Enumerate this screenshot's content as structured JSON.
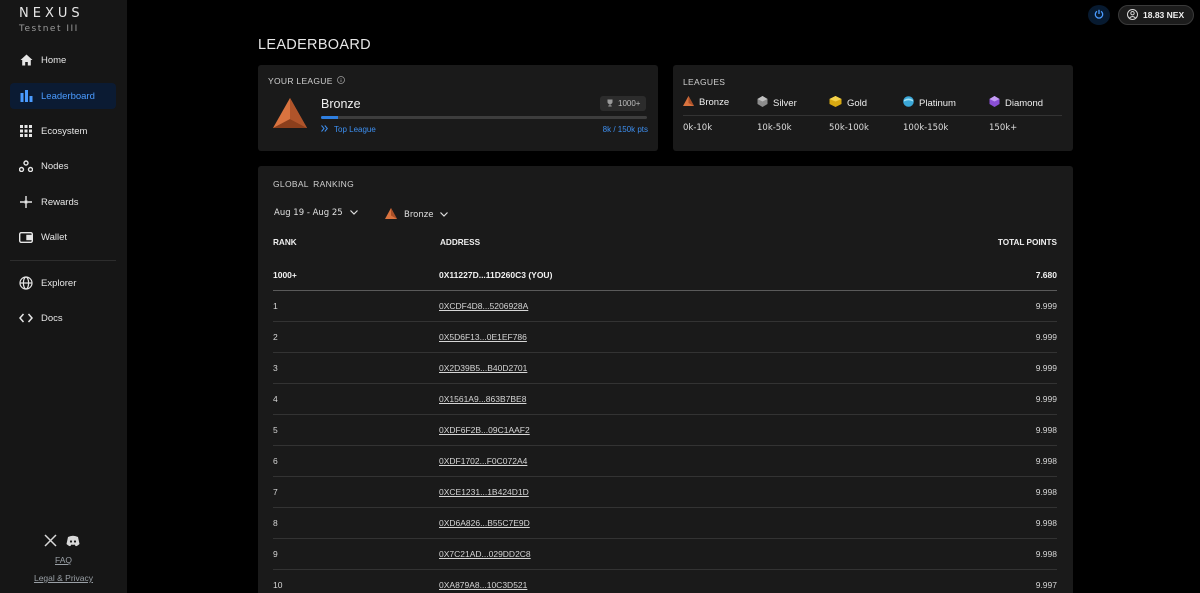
{
  "brand": {
    "name": "NEXUS",
    "sub": "Testnet III"
  },
  "sidebar": {
    "items": [
      {
        "label": "Home",
        "icon": "home-icon",
        "active": false
      },
      {
        "label": "Leaderboard",
        "icon": "bar-chart-icon",
        "active": true
      },
      {
        "label": "Ecosystem",
        "icon": "grid-icon",
        "active": false
      },
      {
        "label": "Nodes",
        "icon": "nodes-icon",
        "active": false
      },
      {
        "label": "Rewards",
        "icon": "sparkle-icon",
        "active": false
      },
      {
        "label": "Wallet",
        "icon": "wallet-icon",
        "active": false
      },
      {
        "label": "Explorer",
        "icon": "globe-icon",
        "active": false
      },
      {
        "label": "Docs",
        "icon": "code-icon",
        "active": false
      }
    ],
    "footer": {
      "faq": "FAQ",
      "legal": "Legal & Privacy"
    }
  },
  "topbar": {
    "balance": "18.83 NEX"
  },
  "page": {
    "title": "LEADERBOARD"
  },
  "your_league": {
    "heading": "YOUR LEAGUE",
    "name": "Bronze",
    "rank": "1000+",
    "progress": 0.053,
    "top_league": "Top League",
    "points": "8k / 150k pts"
  },
  "leagues": {
    "heading": "LEAGUES",
    "items": [
      {
        "name": "Bronze",
        "range": "0k-10k",
        "icon": "bronze-triangle-icon"
      },
      {
        "name": "Silver",
        "range": "10k-50k",
        "icon": "silver-gem-icon"
      },
      {
        "name": "Gold",
        "range": "50k-100k",
        "icon": "gold-gem-icon"
      },
      {
        "name": "Platinum",
        "range": "100k-150k",
        "icon": "platinum-gem-icon"
      },
      {
        "name": "Diamond",
        "range": "150k+",
        "icon": "diamond-gem-icon"
      }
    ]
  },
  "ranking": {
    "heading": "GLOBAL RANKING",
    "date_filter": "Aug 19 - Aug 25",
    "league_filter": "Bronze",
    "columns": {
      "rank": "RANK",
      "address": "ADDRESS",
      "points": "TOTAL POINTS"
    },
    "rows": [
      {
        "rank": "1000+",
        "address": "0X11227D...11D260C3 (YOU)",
        "points": "7.680",
        "you": true
      },
      {
        "rank": "1",
        "address": "0XCDF4D8...5206928A",
        "points": "9.999"
      },
      {
        "rank": "2",
        "address": "0X5D6F13...0E1EF786",
        "points": "9.999"
      },
      {
        "rank": "3",
        "address": "0X2D39B5...B40D2701",
        "points": "9.999"
      },
      {
        "rank": "4",
        "address": "0X1561A9...863B7BE8",
        "points": "9.999"
      },
      {
        "rank": "5",
        "address": "0XDF6F2B...09C1AAF2",
        "points": "9.998"
      },
      {
        "rank": "6",
        "address": "0XDF1702...F0C072A4",
        "points": "9.998"
      },
      {
        "rank": "7",
        "address": "0XCE1231...1B424D1D",
        "points": "9.998"
      },
      {
        "rank": "8",
        "address": "0XD6A826...B55C7E9D",
        "points": "9.998"
      },
      {
        "rank": "9",
        "address": "0X7C21AD...029DD2C8",
        "points": "9.998"
      },
      {
        "rank": "10",
        "address": "0XA879A8...10C3D521",
        "points": "9.997"
      }
    ]
  },
  "colors": {
    "accent": "#3d8ff0",
    "bronze": "#d9733f",
    "background": "#000000",
    "card": "#1a1a1a"
  }
}
